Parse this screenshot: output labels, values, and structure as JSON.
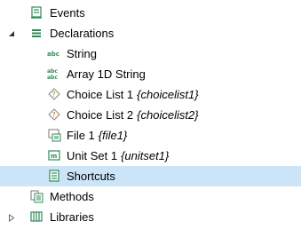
{
  "tree": {
    "events": {
      "label": "Events",
      "icon": "events-icon"
    },
    "declarations": {
      "label": "Declarations",
      "icon": "declarations-icon",
      "expanded": true
    },
    "children": [
      {
        "label": "String",
        "tag": "",
        "icon": "string-icon"
      },
      {
        "label": "Array 1D String",
        "tag": "",
        "icon": "array-string-icon"
      },
      {
        "label": "Choice List 1",
        "tag": "{choicelist1}",
        "icon": "choice-list-icon"
      },
      {
        "label": "Choice List 2",
        "tag": "{choicelist2}",
        "icon": "choice-list-icon"
      },
      {
        "label": "File 1",
        "tag": "{file1}",
        "icon": "file-icon"
      },
      {
        "label": "Unit Set 1",
        "tag": "{unitset1}",
        "icon": "unit-set-icon"
      },
      {
        "label": "Shortcuts",
        "tag": "",
        "icon": "shortcuts-icon",
        "selected": true
      }
    ],
    "methods": {
      "label": "Methods",
      "icon": "methods-icon"
    },
    "libraries": {
      "label": "Libraries",
      "icon": "libraries-icon",
      "expanded": false
    }
  },
  "colors": {
    "selection": "#cce4f7",
    "accent_green": "#2e8b57"
  }
}
